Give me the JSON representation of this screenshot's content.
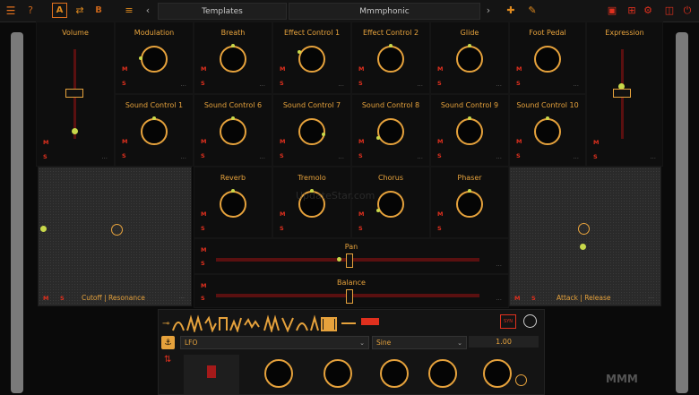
{
  "topbar": {
    "menu_icon": "☰",
    "help_icon": "?",
    "a_label": "A",
    "b_label": "B",
    "prev_icon": "‹",
    "next_icon": "›",
    "templates_label": "Templates",
    "preset_name": "Mmmphonic"
  },
  "cells": [
    {
      "label": "Volume"
    },
    {
      "label": "Modulation"
    },
    {
      "label": "Breath"
    },
    {
      "label": "Effect Control 1"
    },
    {
      "label": "Effect Control 2"
    },
    {
      "label": "Glide"
    },
    {
      "label": "Foot Pedal"
    },
    {
      "label": "Expression"
    },
    {
      "label": "Sound Control 1"
    },
    {
      "label": "Sound Control 6"
    },
    {
      "label": "Sound Control 7"
    },
    {
      "label": "Sound Control 8"
    },
    {
      "label": "Sound Control 9"
    },
    {
      "label": "Sound Control 10"
    },
    {
      "label": "Reverb"
    },
    {
      "label": "Tremolo"
    },
    {
      "label": "Chorus"
    },
    {
      "label": "Phaser"
    }
  ],
  "ms": {
    "m": "M",
    "s": "S",
    "dots": "..."
  },
  "xy_left": {
    "label": "Cutoff | Resonance"
  },
  "xy_right": {
    "label": "Attack | Release"
  },
  "sliders": {
    "pan": "Pan",
    "balance": "Balance"
  },
  "bottom": {
    "lfo_label": "LFO",
    "sine_label": "Sine",
    "value": "1.00"
  },
  "brand": "MMM",
  "watermark": "UpdateStar.com",
  "colors": {
    "accent": "#e6a23c",
    "red": "#e0301e",
    "track": "#5a1010"
  }
}
